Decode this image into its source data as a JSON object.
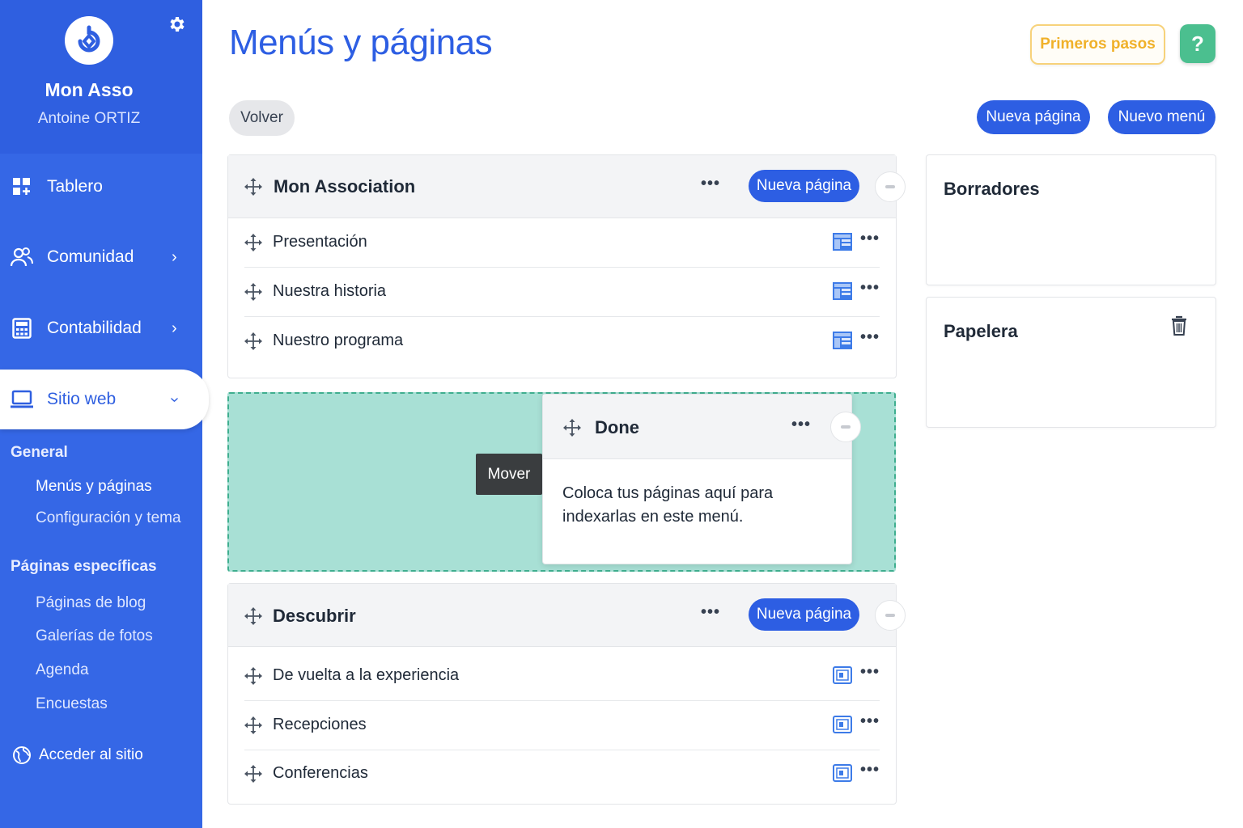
{
  "org": {
    "name": "Mon Asso",
    "user": "Antoine ORTIZ"
  },
  "nav": {
    "tablero": "Tablero",
    "comunidad": "Comunidad",
    "contabilidad": "Contabilidad",
    "sitio_web": "Sitio web"
  },
  "sections": {
    "general": "General",
    "general_links": [
      "Menús y páginas",
      "Configuración y tema"
    ],
    "especificas": "Páginas específicas",
    "especificas_links": [
      "Páginas de blog",
      "Galerías de fotos",
      "Agenda",
      "Encuestas"
    ],
    "acceder": "Acceder al sitio"
  },
  "header": {
    "title": "Menús y páginas",
    "primeros": "Primeros pasos",
    "help": "?",
    "volver": "Volver",
    "nueva_pagina": "Nueva página",
    "nuevo_menu": "Nuevo menú"
  },
  "menus": [
    {
      "title": "Mon Association",
      "button": "Nueva página",
      "pages": [
        "Presentación",
        "Nuestra historia",
        "Nuestro programa"
      ]
    },
    {
      "title": "Done",
      "empty_text_1": "Coloca tus páginas aquí para",
      "empty_text_2": "indexarlas en este menú."
    },
    {
      "title": "Descubrir",
      "button": "Nueva página",
      "pages": [
        "De vuelta a la experiencia",
        "Recepciones",
        "Conferencias"
      ]
    }
  ],
  "tooltip": "Mover",
  "side": {
    "borradores": "Borradores",
    "papelera": "Papelera"
  },
  "dots": "•••",
  "colors": {
    "primary": "#2d5ee3",
    "sidebar": "#3567e6",
    "dropzone": "#a8e0d5",
    "help": "#4bbf8f",
    "primeros": "#f0b12a"
  }
}
